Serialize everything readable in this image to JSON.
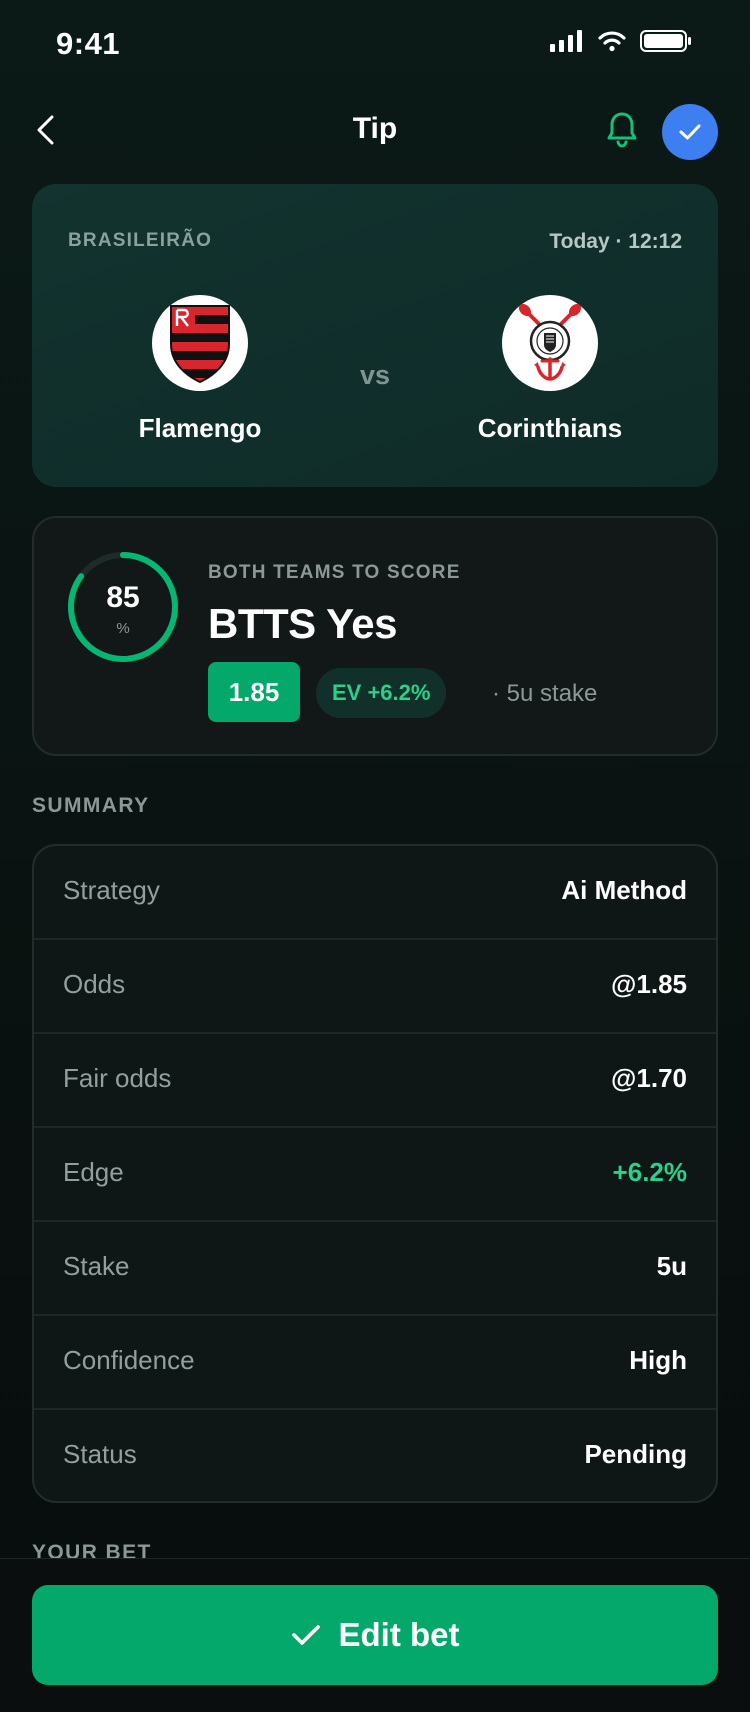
{
  "status_bar": {
    "time": "9:41"
  },
  "nav": {
    "title": "Tip"
  },
  "match": {
    "league": "BRASILEIRÃO",
    "kickoff": "Today · 12:12",
    "vs": "vs",
    "home_team": "Flamengo",
    "away_team": "Corinthians"
  },
  "tip": {
    "confidence": "85",
    "confidence_unit": "%",
    "confidence_fraction": 0.85,
    "market": "BOTH TEAMS TO SCORE",
    "selection": "BTTS Yes",
    "odds": "1.85",
    "ev": "EV +6.2%",
    "stake": "· 5u stake"
  },
  "summary": {
    "title": "SUMMARY",
    "rows": [
      {
        "label": "Strategy",
        "value": "Ai Method"
      },
      {
        "label": "Odds",
        "value": "@1.85"
      },
      {
        "label": "Fair odds",
        "value": "@1.70"
      },
      {
        "label": "Edge",
        "value": "+6.2%"
      },
      {
        "label": "Stake",
        "value": "5u"
      },
      {
        "label": "Confidence",
        "value": "High"
      },
      {
        "label": "Status",
        "value": "Pending"
      }
    ]
  },
  "your_bet": {
    "title": "YOUR BET"
  },
  "footer": {
    "button_label": "Edit bet"
  },
  "colors": {
    "accent_green": "#04a86a",
    "positive_text": "#2bd08a",
    "accent_blue": "#3d7ef0",
    "flamengo_red": "#d7262d",
    "corinthians_red": "#d7262d"
  },
  "icons": {
    "back": "chevron-left-icon",
    "bell": "bell-icon",
    "check": "check-icon",
    "edit": "check-icon"
  }
}
